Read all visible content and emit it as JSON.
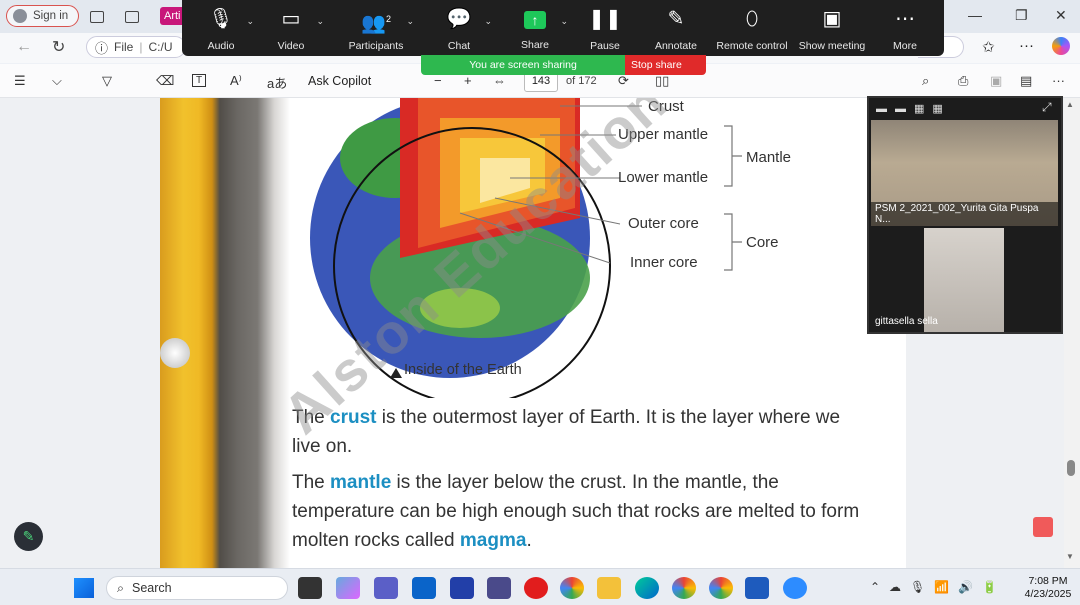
{
  "browser": {
    "signin_label": "Sign in",
    "tab_label": "Arti",
    "url_prefix": "File",
    "url_text": "C:/U"
  },
  "pdf_toolbar": {
    "ask_copilot": "Ask Copilot",
    "current_page": "143",
    "page_of": "of 172"
  },
  "zoom": {
    "buttons": [
      {
        "label": "Audio",
        "icon": "microphone-icon"
      },
      {
        "label": "Video",
        "icon": "video-camera-icon"
      },
      {
        "label": "Participants",
        "icon": "participants-icon",
        "count": "2"
      },
      {
        "label": "Chat",
        "icon": "chat-icon"
      },
      {
        "label": "Share",
        "icon": "share-screen-icon"
      },
      {
        "label": "Pause",
        "icon": "pause-icon"
      },
      {
        "label": "Annotate",
        "icon": "pencil-icon"
      },
      {
        "label": "Remote control",
        "icon": "mouse-icon"
      },
      {
        "label": "Show meeting",
        "icon": "meeting-window-icon"
      },
      {
        "label": "More",
        "icon": "ellipsis-icon"
      }
    ],
    "sharing_banner": "You are screen sharing",
    "stop_share": "Stop share",
    "participants_video": [
      {
        "name": "PSM 2_2021_002_Yurita Gita Puspa N..."
      },
      {
        "name": "gittasella sella"
      }
    ]
  },
  "document": {
    "figure_labels": {
      "crust": "Crust",
      "upper_mantle": "Upper mantle",
      "lower_mantle": "Lower mantle",
      "mantle": "Mantle",
      "outer_core": "Outer core",
      "inner_core": "Inner core",
      "core": "Core",
      "caption": "Inside of the Earth"
    },
    "para1": {
      "pre": "The ",
      "kw": "crust",
      "post": " is the outermost layer of Earth. It is the layer where we live on."
    },
    "para2": {
      "pre": "The ",
      "kw": "mantle",
      "mid": " is the layer below the crust. In the mantle, the temperature can be high enough such that rocks are melted to form molten rocks called ",
      "kw2": "magma",
      "post": "."
    },
    "watermark": "Alston Education"
  },
  "taskbar": {
    "search_placeholder": "Search",
    "time": "7:08 PM",
    "date": "4/23/2025"
  },
  "colors": {
    "zoom_bg": "#1f1f1f",
    "sharing_green": "#2eb84f",
    "stop_red": "#e02a2a",
    "keyword_blue": "#1c8fc2"
  }
}
